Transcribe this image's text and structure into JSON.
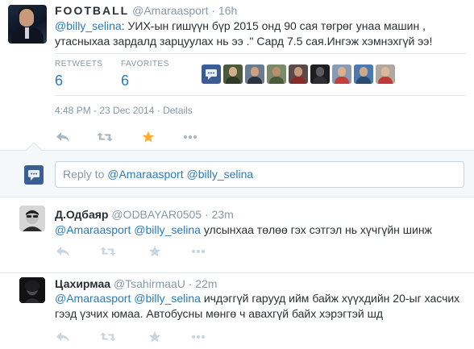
{
  "main_tweet": {
    "fullname": "FOOTBALL",
    "username": "@Amaraasport",
    "separator": "·",
    "time": "16h",
    "text": {
      "mention": "@billy_selina",
      "body": ": УИХ-ын гишүүн бүр  2015 онд 90 сая төгрөг унаа машин , утасныхаа зардалд зарцуулах нь ээ .\" Сард 7.5 сая.Ингэж хэмнэхгүй ээ!"
    },
    "stats": {
      "retweets_label": "RETWEETS",
      "retweets_value": "6",
      "favorites_label": "FAVORITES",
      "favorites_value": "6"
    },
    "favoriter_avatars": [
      {
        "bg": "#3b5d94",
        "head": "#e9eef5",
        "body": "#e9eef5",
        "icon": "speech-bubble-avatar"
      },
      {
        "bg": "#4a5a3a",
        "head": "#d2b08e",
        "body": "#2f3a24",
        "icon": "person-avatar"
      },
      {
        "bg": "#6a7c8e",
        "head": "#cfa07e",
        "body": "#2a3440",
        "icon": "person-avatar"
      },
      {
        "bg": "#7a8a6a",
        "head": "#b89070",
        "body": "#4a5a3a",
        "icon": "person-avatar"
      },
      {
        "bg": "#5a4a4a",
        "head": "#c49a7a",
        "body": "#8a2a2a",
        "icon": "person-avatar"
      },
      {
        "bg": "#1e1e22",
        "head": "#5a5a60",
        "body": "#2e2e34",
        "icon": "person-avatar"
      },
      {
        "bg": "#8a9ab0",
        "head": "#d8b090",
        "body": "#c04040",
        "icon": "person-avatar"
      },
      {
        "bg": "#4a7ab0",
        "head": "#cfa888",
        "body": "#2a4a70",
        "icon": "person-avatar"
      },
      {
        "bg": "#b0a8a0",
        "head": "#dcb89a",
        "body": "#c03a3a",
        "icon": "person-avatar"
      }
    ],
    "date_text": "4:48 PM - 23 Dec 2014",
    "details_label": "Details"
  },
  "reply_box": {
    "prefix": "Reply to ",
    "mentions": "@Amaraasport @billy_selina"
  },
  "replies": [
    {
      "name": "Д.Одбаяр",
      "handle": "@ODBAYAR0505",
      "separator": "·",
      "time": "23m",
      "mentions": "@Amaraasport @billy_selina",
      "text": " улсынхаа төлөө гэх сэтгэл нь хүчгүйн шинж"
    },
    {
      "name": "Цахирмаа",
      "handle": "@TsahirmaaU",
      "separator": "·",
      "time": "22m",
      "mentions": "@Amaraasport @billy_selina",
      "text": " ичдэггүй гарууд ийм байж хүүхдийн 20-ыг хасчих гээд үзчих юмаа. Автобусны мөнгө ч авахгүй байх хэрэгтэй шд"
    }
  ],
  "colors": {
    "link": "#2b7bb9",
    "muted": "#8899a6",
    "text": "#292f33",
    "favorite_star": "#ffac33",
    "action_icon": "#ccd6dd",
    "action_icon_main": "#aab8c2"
  }
}
